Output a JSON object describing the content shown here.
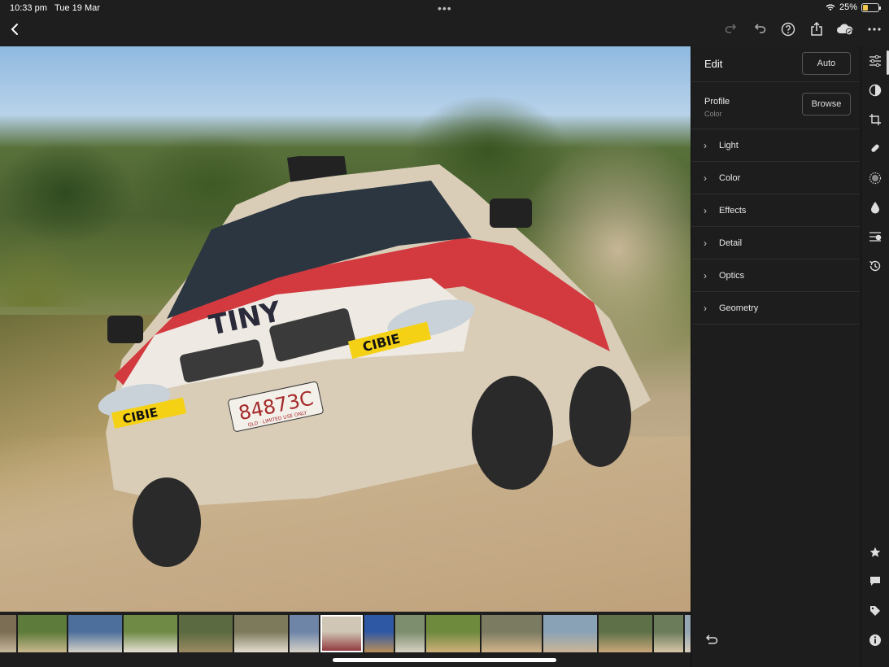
{
  "status_bar": {
    "time": "10:33 pm",
    "date": "Tue 19 Mar",
    "battery": "25%",
    "icons": [
      "wifi-icon",
      "battery-charging-icon"
    ]
  },
  "toolbar": {
    "icons": [
      "back-icon",
      "redo-icon",
      "undo-icon",
      "help-icon",
      "share-icon",
      "cloud-sync-icon",
      "more-icon"
    ]
  },
  "photo": {
    "plate_text": "84873C",
    "plate_sub": "QLD · LIMITED USE ONLY",
    "hood_text": "TINY",
    "sponsor": "CIBIE"
  },
  "panel": {
    "title": "Edit",
    "auto_label": "Auto",
    "profile_label": "Profile",
    "profile_value": "Color",
    "browse_label": "Browse",
    "sections": [
      "Light",
      "Color",
      "Effects",
      "Detail",
      "Optics",
      "Geometry"
    ]
  },
  "rail": {
    "top_icons": [
      "sliders-icon",
      "presets-icon",
      "crop-icon",
      "healing-brush-icon",
      "masking-icon",
      "selective-icon",
      "versions-icon",
      "history-icon"
    ],
    "bottom_icons": [
      "star-icon",
      "comment-icon",
      "tag-icon",
      "info-icon"
    ]
  },
  "filmstrip": {
    "count": 16,
    "selected_index": 6
  },
  "colors": {
    "background": "#1e1e1e",
    "panel": "#1d1d1d",
    "accent_battery": "#f2c94c",
    "car_red": "#d33a3f",
    "cibie_yellow": "#f5d116"
  }
}
